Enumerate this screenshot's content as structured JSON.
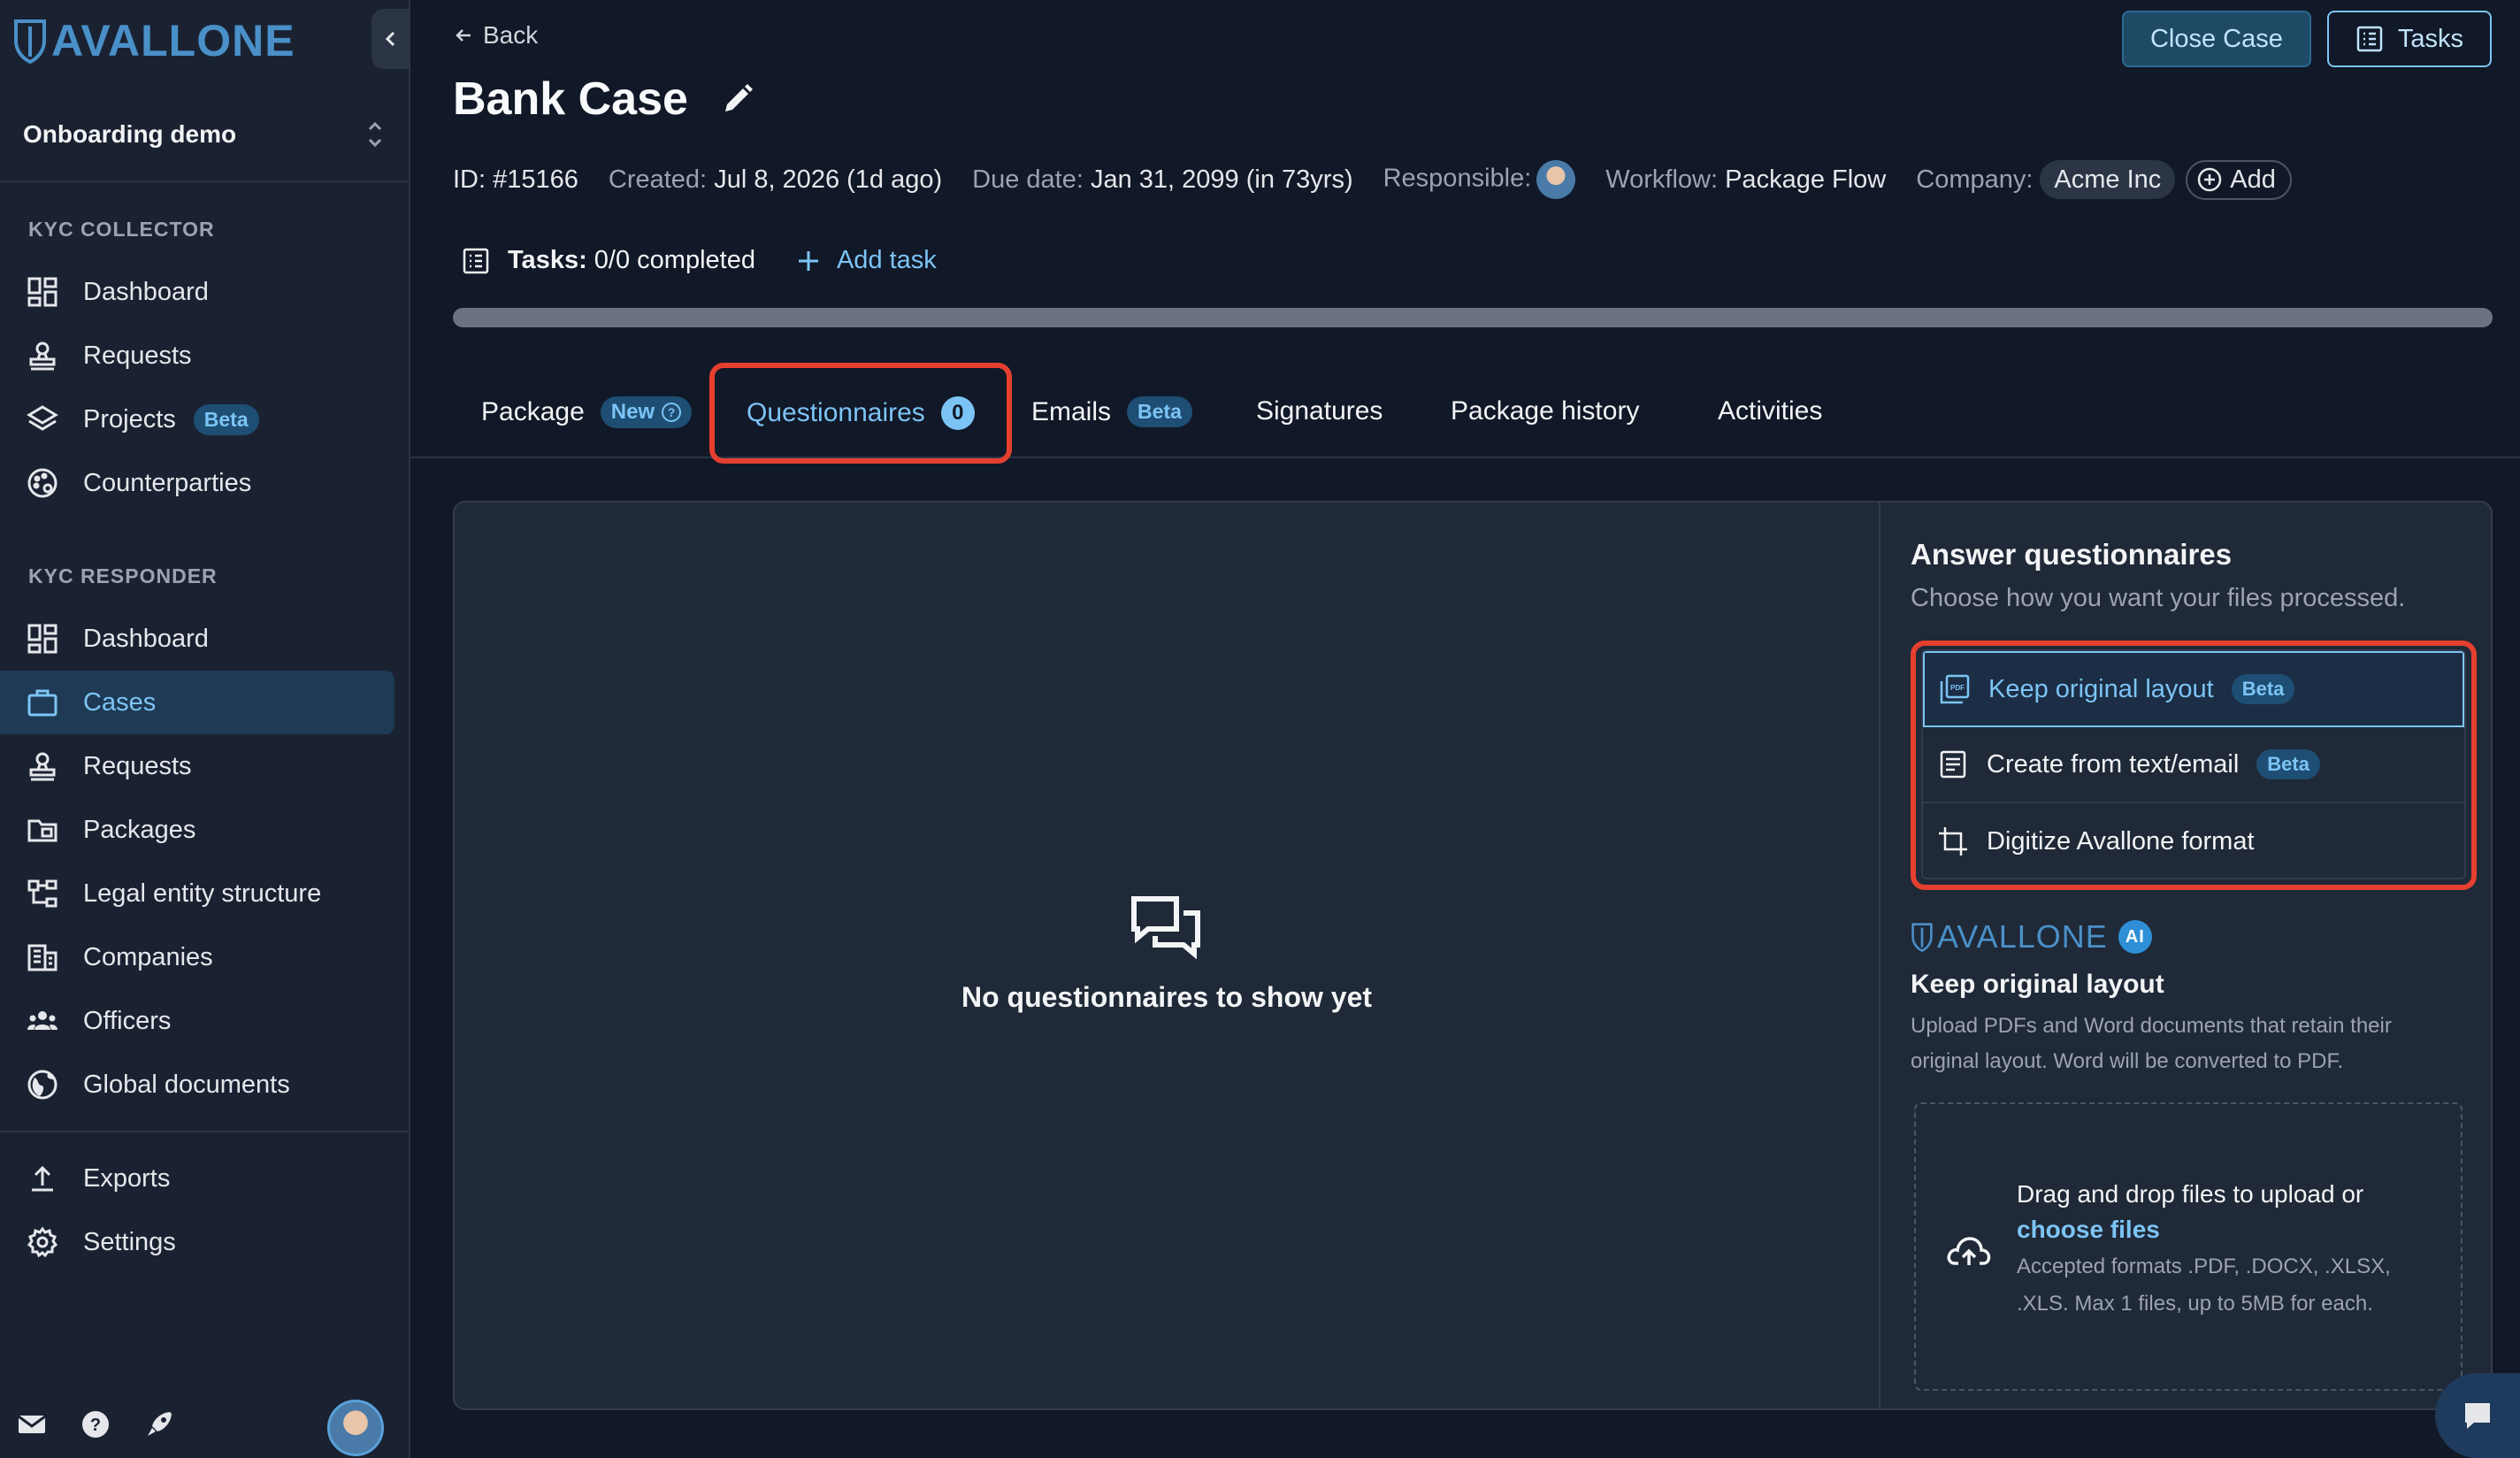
{
  "brand": {
    "logo_text": "AVALLONE"
  },
  "sidebar": {
    "org_name": "Onboarding demo",
    "sections": [
      {
        "label": "KYC COLLECTOR"
      },
      {
        "label": "KYC RESPONDER"
      }
    ],
    "collector_items": [
      {
        "label": "Dashboard",
        "icon": "dashboard-icon"
      },
      {
        "label": "Requests",
        "icon": "stamp-icon"
      },
      {
        "label": "Projects",
        "icon": "layers-icon",
        "badge": "Beta"
      },
      {
        "label": "Counterparties",
        "icon": "palette-icon"
      }
    ],
    "responder_items": [
      {
        "label": "Dashboard",
        "icon": "dashboard-icon"
      },
      {
        "label": "Cases",
        "icon": "briefcase-icon",
        "active": true
      },
      {
        "label": "Requests",
        "icon": "stamp-icon"
      },
      {
        "label": "Packages",
        "icon": "folder-icon"
      },
      {
        "label": "Legal entity structure",
        "icon": "hierarchy-icon"
      },
      {
        "label": "Companies",
        "icon": "building-icon"
      },
      {
        "label": "Officers",
        "icon": "people-icon"
      },
      {
        "label": "Global documents",
        "icon": "globe-icon"
      }
    ],
    "bottom_items": [
      {
        "label": "Exports",
        "icon": "upload-icon"
      },
      {
        "label": "Settings",
        "icon": "gear-icon"
      }
    ]
  },
  "header": {
    "back_label": "Back",
    "close_case_label": "Close Case",
    "tasks_label": "Tasks",
    "title": "Bank Case"
  },
  "meta": {
    "id": "ID: #15166",
    "created_label": "Created:",
    "created_value": "Jul 8, 2026 (1d ago)",
    "due_label": "Due date:",
    "due_value": "Jan 31, 2099 (in 73yrs)",
    "responsible_label": "Responsible:",
    "workflow_label": "Workflow:",
    "workflow_value": "Package Flow",
    "company_label": "Company:",
    "company_value": "Acme Inc",
    "add_label": "Add"
  },
  "tasks": {
    "label": "Tasks:",
    "value": "0/0 completed",
    "add_label": "Add task",
    "progress_percent": 0
  },
  "tabs": [
    {
      "label": "Package",
      "badge": "New"
    },
    {
      "label": "Questionnaires",
      "count": "0",
      "active": true
    },
    {
      "label": "Emails",
      "badge": "Beta"
    },
    {
      "label": "Signatures"
    },
    {
      "label": "Package history"
    },
    {
      "label": "Activities"
    }
  ],
  "empty_state": {
    "text": "No questionnaires to show yet"
  },
  "answer": {
    "title": "Answer questionnaires",
    "subtitle": "Choose how you want your files processed.",
    "options": [
      {
        "label": "Keep original layout",
        "badge": "Beta",
        "selected": true
      },
      {
        "label": "Create from text/email",
        "badge": "Beta"
      },
      {
        "label": "Digitize Avallone format"
      }
    ],
    "ai_brand": "AVALLONE",
    "ai_badge": "AI",
    "detail_title": "Keep original layout",
    "detail_desc": "Upload PDFs and Word documents that retain their original layout. Word will be converted to PDF.",
    "drop_text": "Drag and drop files to upload or",
    "drop_link": "choose files",
    "drop_formats": "Accepted formats .PDF, .DOCX, .XLSX, .XLS. Max 1 files, up to 5MB for each."
  },
  "colors": {
    "accent": "#7cc4f5",
    "highlight": "#e5402f",
    "bg": "#111827"
  }
}
